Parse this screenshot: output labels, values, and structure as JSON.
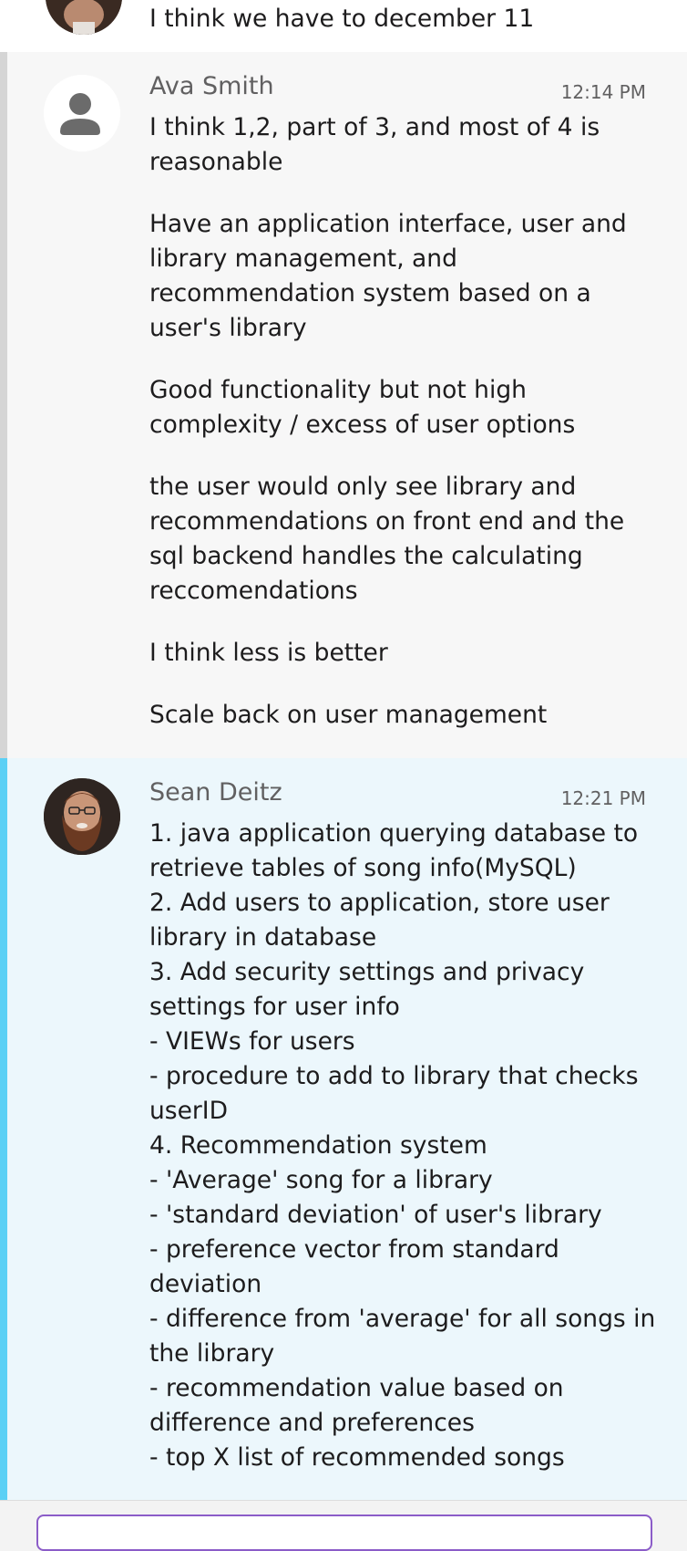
{
  "previous_message": {
    "text": "I think we have to december 11"
  },
  "messages": [
    {
      "sender": "Ava Smith",
      "time": "12:14 PM",
      "paragraphs": [
        "I think 1,2, part of 3, and most of 4 is reasonable",
        "Have an application interface, user and library management, and recommendation system based on a user's library",
        "Good functionality but not high complexity / excess of user options",
        "the user would only see library and recommendations on front end and the sql backend handles the calculating reccomendations",
        "I think less is better",
        "Scale back on user management"
      ]
    },
    {
      "sender": "Sean Deitz",
      "time": "12:21 PM",
      "lines": [
        "1. java application querying database to retrieve tables of song info(MySQL)",
        "2. Add users to application, store user library in database",
        "3. Add security settings and privacy settings for user info",
        "- VIEWs for users",
        "- procedure to add to library that checks userID",
        "4. Recommendation system",
        "- 'Average' song for a library",
        "- 'standard deviation' of user's library",
        "- preference vector from standard deviation",
        "- difference from 'average' for all songs in the library",
        "- recommendation value based on difference and preferences",
        "- top X list of recommended songs"
      ]
    }
  ],
  "colors": {
    "thread_highlight": "#5bd0f5",
    "thread_default": "#d5d5d5",
    "composer_border": "#8b5cc8"
  }
}
